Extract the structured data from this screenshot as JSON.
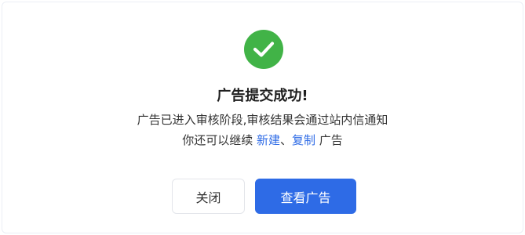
{
  "dialog": {
    "title": "广告提交成功!",
    "message_line1": "广告已进入审核阶段,审核结果会通过站内信通知",
    "message_line2_prefix": "你还可以继续 ",
    "link_new": "新建",
    "separator": "、",
    "link_copy": "复制",
    "message_line2_suffix": " 广告",
    "close_label": "关闭",
    "view_label": "查看广告"
  },
  "icons": {
    "success": "check-circle-icon"
  },
  "colors": {
    "success": "#41b347",
    "primary": "#2e6be6",
    "text": "#333333",
    "title": "#1f1f1f",
    "border": "#e3e5ea"
  }
}
